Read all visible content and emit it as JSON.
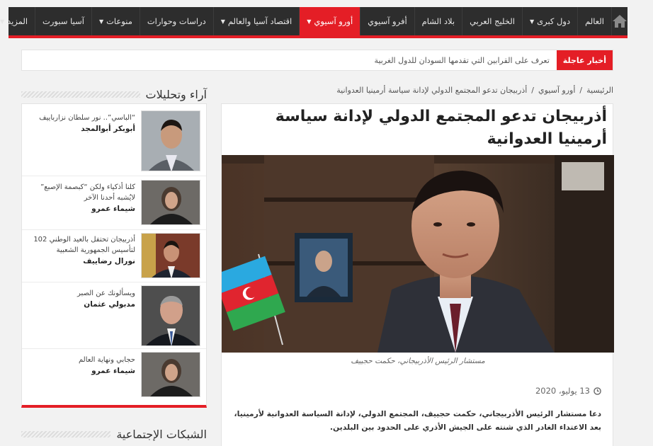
{
  "nav": {
    "items": [
      {
        "label": "العالم",
        "caret": false,
        "active": false
      },
      {
        "label": "دول كبرى",
        "caret": true,
        "active": false
      },
      {
        "label": "الخليج العربي",
        "caret": false,
        "active": false
      },
      {
        "label": "بلاد الشام",
        "caret": false,
        "active": false
      },
      {
        "label": "أفرو آسيوي",
        "caret": false,
        "active": false
      },
      {
        "label": "أورو آسيوي",
        "caret": true,
        "active": true
      },
      {
        "label": "اقتصاد آسيا والعالم",
        "caret": true,
        "active": false
      },
      {
        "label": "دراسات وحوارات",
        "caret": false,
        "active": false
      },
      {
        "label": "منوعات",
        "caret": true,
        "active": false
      },
      {
        "label": "آسيا سبورت",
        "caret": false,
        "active": false
      },
      {
        "label": "المزيد",
        "caret": true,
        "active": false
      }
    ],
    "accent": "#e41e26",
    "bg": "#2d2d2d"
  },
  "breaking": {
    "tag": "أخبار عاجلة",
    "text": "تعرف على القرابين التي تقدمها السودان للدول الغربية"
  },
  "breadcrumb": {
    "home": "الرئيسية",
    "section": "أورو آسيوي",
    "current": "أذربيجان تدعو المجتمع الدولي لإدانة سياسة أرمينيا العدوانية",
    "separator": "/"
  },
  "article": {
    "title": "أذربيجان تدعو المجتمع الدولي لإدانة سياسة أرمينيا العدوانية",
    "caption": "مستشار الرئيس الأذربيجاني، حكمت حجييف",
    "date": "13 يوليو، 2020",
    "body": "دعا مستشار الرئيس الأذربيجاني، حكمت حجييف، المجتمع الدولي، لإدانة السياسة العدوانية لأرمينيا، بعد الاعتداء الغادر الذي شنته على الجيش الأذري على الحدود بين البلدين."
  },
  "sidebar": {
    "opinions_title": "آراء وتحليلات",
    "social_title": "الشبكات الإجتماعية",
    "opinions": [
      {
        "quote": "“الباسي”.. نور سلطان نزارباييف",
        "author": "أبوبكر أبوالمجد"
      },
      {
        "quote": "كلنا أذكياء ولكن “كبصمة الإصبع” لايُشبه أحدنا الآخر",
        "author": "شيماء عمرو"
      },
      {
        "quote": "أذربيجان تحتفل بالعيد الوطني 102 لتأسيس الجمهورية الشعبية",
        "author": "نورال رضاييف"
      },
      {
        "quote": "ويسألونك عن الصبر",
        "author": "مدبولي عثمان"
      },
      {
        "quote": "حجابي ونهاية العالم",
        "author": "شيماء عمرو"
      }
    ]
  }
}
